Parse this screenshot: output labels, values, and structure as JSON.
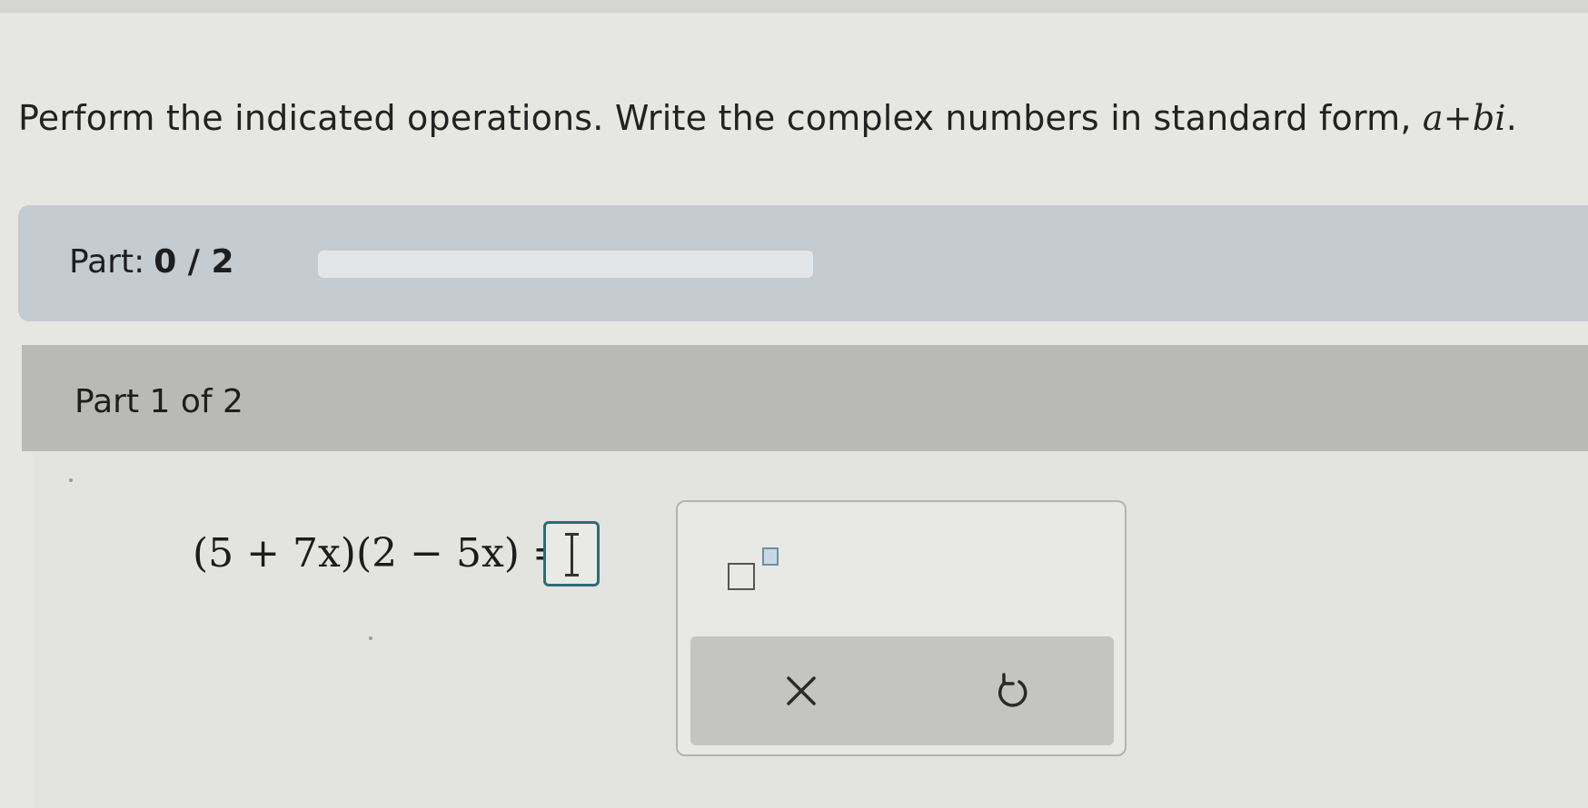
{
  "instructions": {
    "text": "Perform the indicated operations. Write the complex numbers in standard form, ",
    "form": "a+bi",
    "end": "."
  },
  "progress": {
    "label": "Part:",
    "count": "0 / 2",
    "completed": 0,
    "total": 2,
    "fill_fraction": 0,
    "fill_color": "#3f7fb0"
  },
  "part": {
    "label": "Part 1 of 2"
  },
  "problem": {
    "expression": "(5 + 7x)(2 − 5x) =",
    "answer_value": ""
  },
  "keypad": {
    "exponent_icon": "superscript-template-icon",
    "clear_icon": "close-icon",
    "undo_icon": "undo-icon"
  }
}
